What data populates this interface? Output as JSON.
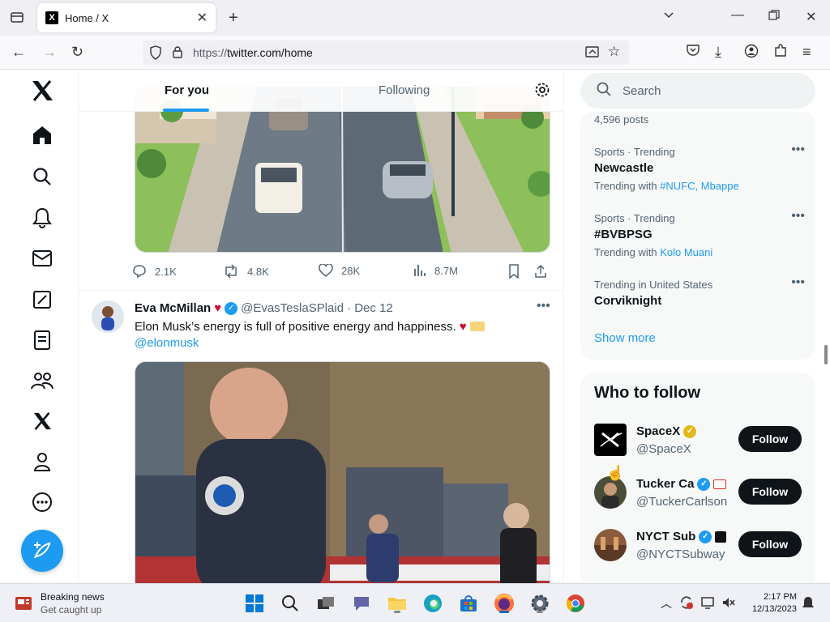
{
  "browser": {
    "tab_title": "Home / X",
    "url_prefix": "https://",
    "url_main": "twitter.com/home"
  },
  "feed": {
    "tab_for_you": "For you",
    "tab_following": "Following",
    "tweet1_stats": {
      "replies": "2.1K",
      "retweets": "4.8K",
      "likes": "28K",
      "views": "8.7M"
    },
    "tweet2": {
      "name": "Eva McMillan",
      "handle": "@EvasTeslaSPlaid",
      "date": "· Dec 12",
      "text": "Elon Musk’s energy is full of positive energy and happiness.",
      "mention": "@elonmusk"
    }
  },
  "sidebar": {
    "search_placeholder": "Search",
    "trends_partial": "4,596 posts",
    "trends": [
      {
        "meta": "Sports · Trending",
        "name": "Newcastle",
        "with_prefix": "Trending with",
        "with_links": "#NUFC, Mbappe"
      },
      {
        "meta": "Sports · Trending",
        "name": "#BVBPSG",
        "with_prefix": "Trending with",
        "with_links": "Kolo Muani"
      },
      {
        "meta": "Trending in United States",
        "name": "Corviknight"
      }
    ],
    "show_more": "Show more",
    "who_to_follow": "Who to follow",
    "follow_suggestions": [
      {
        "name": "SpaceX",
        "handle": "@SpaceX",
        "button": "Follow"
      },
      {
        "name": "Tucker Ca",
        "handle": "@TuckerCarlson",
        "button": "Follow"
      },
      {
        "name": "NYCT Sub",
        "handle": "@NYCTSubway",
        "button": "Follow"
      }
    ]
  },
  "taskbar": {
    "news_title": "Breaking news",
    "news_sub": "Get caught up",
    "time": "2:17 PM",
    "date": "12/13/2023"
  }
}
